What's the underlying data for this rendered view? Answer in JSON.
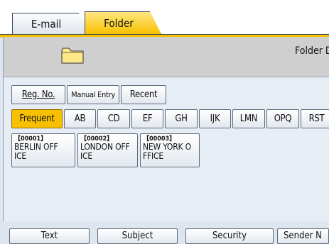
{
  "tabs": [
    {
      "label": "E-mail"
    },
    {
      "label": "Folder"
    }
  ],
  "banner": {
    "folder_label": "Folder D"
  },
  "actions": {
    "reg_no": "Reg. No.",
    "manual_entry": "Manual Entry",
    "recent": "Recent"
  },
  "index_tabs": [
    "Frequent",
    "AB",
    "CD",
    "EF",
    "GH",
    "IJK",
    "LMN",
    "OPQ",
    "RST"
  ],
  "selected_index_tab": "Frequent",
  "entries": [
    {
      "number": "【00001】",
      "name": "BERLIN OFF\nICE"
    },
    {
      "number": "【00002】",
      "name": "LONDON OFF\nICE"
    },
    {
      "number": "【00003】",
      "name": "NEW YORK O\nFFICE"
    }
  ],
  "columns": [
    "Text",
    "Subject",
    "Security",
    "Sender N"
  ],
  "colors": {
    "accent": "#f8c000",
    "background": "#e6edf5"
  }
}
